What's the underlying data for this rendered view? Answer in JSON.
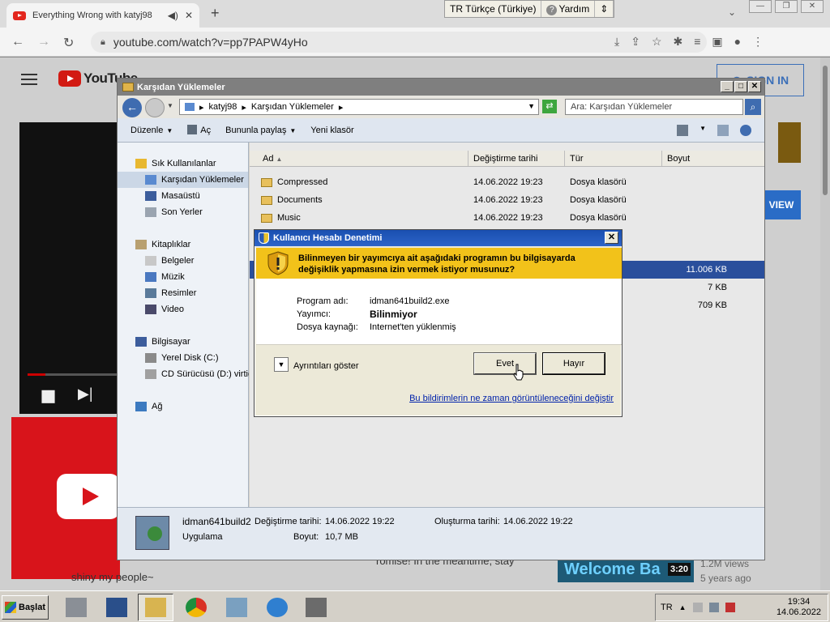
{
  "browser": {
    "tab_title": "Everything Wrong with katyj98",
    "new_tab": "+",
    "url": "youtube.com/watch?v=pp7PAPW4yHo"
  },
  "language_bar": {
    "language": "TR Türkçe (Türkiye)",
    "help": "Yardım"
  },
  "youtube": {
    "logo_text": "YouTube",
    "sign_in": "SIGN IN",
    "caption_left": "shiny my people~",
    "caption_right": "romise! In the meantime, stay",
    "thumb_title": "Welcome Ba",
    "thumb_duration": "3:20",
    "views": "1.2M views",
    "age": "5 years ago",
    "ad_button": "VIEW"
  },
  "explorer": {
    "title": "Karşıdan Yüklemeler",
    "breadcrumb": [
      "katyj98",
      "Karşıdan Yüklemeler"
    ],
    "search_placeholder": "Ara: Karşıdan Yüklemeler",
    "toolbar": {
      "organize": "Düzenle",
      "open": "Aç",
      "share": "Bununla paylaş",
      "new_folder": "Yeni klasör"
    },
    "nav": {
      "favorites": "Sık Kullanılanlar",
      "downloads": "Karşıdan Yüklemeler",
      "desktop": "Masaüstü",
      "recent": "Son Yerler",
      "libraries": "Kitaplıklar",
      "documents": "Belgeler",
      "music": "Müzik",
      "pictures": "Resimler",
      "video": "Video",
      "computer": "Bilgisayar",
      "local_disk": "Yerel Disk (C:)",
      "cd_drive": "CD Sürücüsü (D:) virtio",
      "network": "Ağ"
    },
    "columns": {
      "name": "Ad",
      "modified": "Değiştirme tarihi",
      "type": "Tür",
      "size": "Boyut"
    },
    "rows": [
      {
        "name": "Compressed",
        "modified": "14.06.2022 19:23",
        "type": "Dosya klasörü"
      },
      {
        "name": "Documents",
        "modified": "14.06.2022 19:23",
        "type": "Dosya klasörü"
      },
      {
        "name": "Music",
        "modified": "14.06.2022 19:23",
        "type": "Dosya klasörü"
      }
    ],
    "sizes": [
      "11.006 KB",
      "7 KB",
      "709 KB"
    ],
    "details": {
      "file_name": "idman641build2",
      "file_type": "Uygulama",
      "modified_label": "Değiştirme tarihi:",
      "modified_value": "14.06.2022 19:22",
      "size_label": "Boyut:",
      "size_value": "10,7 MB",
      "created_label": "Oluşturma tarihi:",
      "created_value": "14.06.2022 19:22"
    }
  },
  "uac": {
    "title": "Kullanıcı Hesabı Denetimi",
    "message": "Bilinmeyen bir yayımcıya ait aşağıdaki programın bu bilgisayarda değişiklik yapmasına izin vermek istiyor musunuz?",
    "program_label": "Program adı:",
    "program_value": "idman641build2.exe",
    "publisher_label": "Yayımcı:",
    "publisher_value": "Bilinmiyor",
    "source_label": "Dosya kaynağı:",
    "source_value": "Internet'ten yüklenmiş",
    "details_toggle": "Ayrıntıları göster",
    "yes": "Evet",
    "no": "Hayır",
    "link": "Bu bildirimlerin ne zaman görüntüleneceğini değiştir"
  },
  "taskbar": {
    "start": "Başlat",
    "language": "TR",
    "time": "19:34",
    "date": "14.06.2022"
  }
}
